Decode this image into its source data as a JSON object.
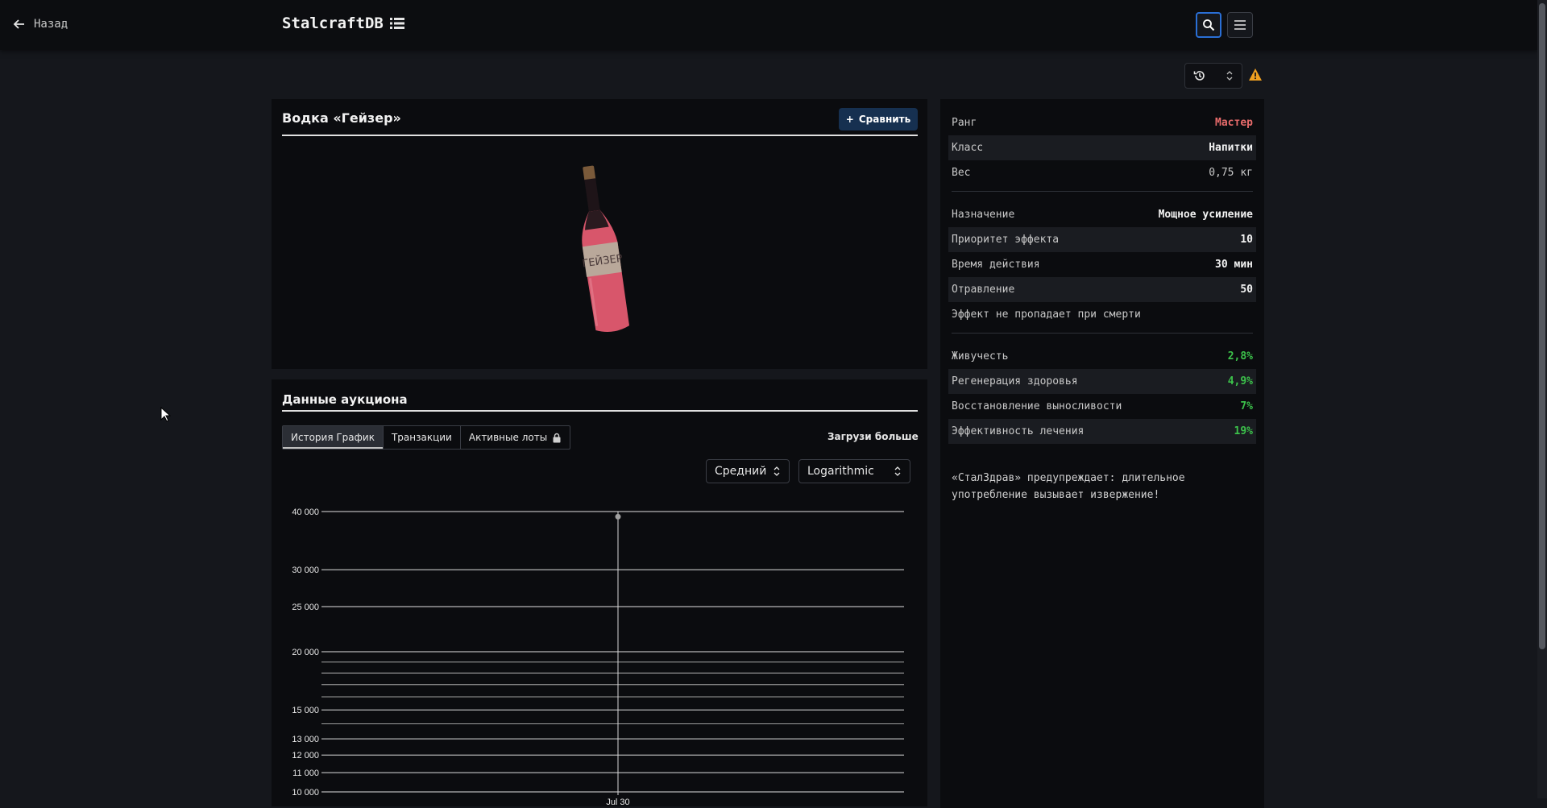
{
  "header": {
    "back_label": "Назад",
    "logo": "StalcraftDB"
  },
  "item": {
    "name": "Водка «Гейзер»",
    "compare_label": "Сравнить",
    "bottle_label": "ГЕЙЗЕР"
  },
  "auction": {
    "title": "Данные аукциона",
    "tabs": [
      {
        "label": "История График"
      },
      {
        "label": "Транзакции"
      },
      {
        "label": "Активные лоты"
      }
    ],
    "load_more": "Загрузи больше",
    "avg_select": "Средний",
    "scale_select": "Logarithmic"
  },
  "chart_data": {
    "type": "scatter",
    "scale": "log",
    "y_ticks": [
      "40 000",
      "30 000",
      "25 000",
      "20 000",
      "15 000",
      "13 000",
      "12 000",
      "11 000",
      "10 000"
    ],
    "y_tick_values": [
      40000,
      30000,
      25000,
      20000,
      15000,
      13000,
      12000,
      11000,
      10000
    ],
    "minor_ticks": [
      19000,
      18000,
      17000,
      16000,
      14000
    ],
    "x_ticks": [
      "Jul 30"
    ],
    "points": [
      {
        "x": "Jul 30",
        "y": 39000
      }
    ],
    "ylim": [
      10000,
      40000
    ]
  },
  "stats": {
    "group1": [
      {
        "label": "Ранг",
        "value": "Мастер",
        "style": "red"
      },
      {
        "label": "Класс",
        "value": "Напитки",
        "style": "bold"
      },
      {
        "label": "Вес",
        "value": "0,75 кг",
        "style": "gray"
      }
    ],
    "group2": [
      {
        "label": "Назначение",
        "value": "Мощное усиление",
        "style": "bold"
      },
      {
        "label": "Приоритет эффекта",
        "value": "10",
        "style": "bold"
      },
      {
        "label": "Время действия",
        "value": "30 мин",
        "style": "bold"
      },
      {
        "label": "Отравление",
        "value": "50",
        "style": "bold"
      },
      {
        "label": "Эффект не пропадает при смерти",
        "value": "",
        "style": "bold"
      }
    ],
    "group3": [
      {
        "label": "Живучесть",
        "value": "2,8%",
        "style": "green"
      },
      {
        "label": "Регенерация здоровья",
        "value": "4,9%",
        "style": "green"
      },
      {
        "label": "Восстановление выносливости",
        "value": "7%",
        "style": "green"
      },
      {
        "label": "Эффективность лечения",
        "value": "19%",
        "style": "green"
      }
    ],
    "note": "«СталЗдрав» предупреждает: длительное употребление вызывает извержение!"
  },
  "colors": {
    "accent_blue": "#2a6fd6",
    "rank_red": "#e86b6b",
    "bonus_green": "#3cc24b",
    "warning_orange": "#f0a020"
  }
}
